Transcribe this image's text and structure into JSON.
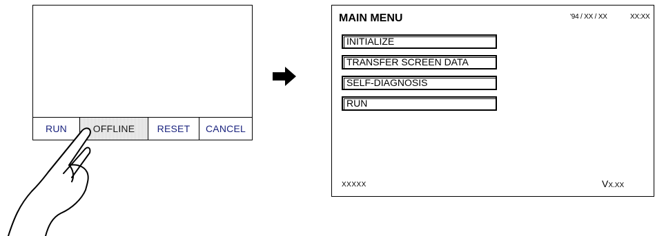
{
  "left_screen": {
    "buttons": [
      "RUN",
      "OFFLINE",
      "RESET",
      "CANCEL"
    ]
  },
  "right_screen": {
    "title": "MAIN MENU",
    "date": "'94 / XX / XX",
    "time": "XX:XX",
    "menu_items": [
      "INITIALIZE",
      "TRANSFER SCREEN DATA",
      "SELF-DIAGNOSIS",
      "RUN"
    ],
    "footer_left": "XXXXX",
    "version_prefix": "V",
    "version_value": "X.XX"
  },
  "icons": {
    "arrow": "arrow-right-icon",
    "hand": "pointing-hand-icon"
  }
}
